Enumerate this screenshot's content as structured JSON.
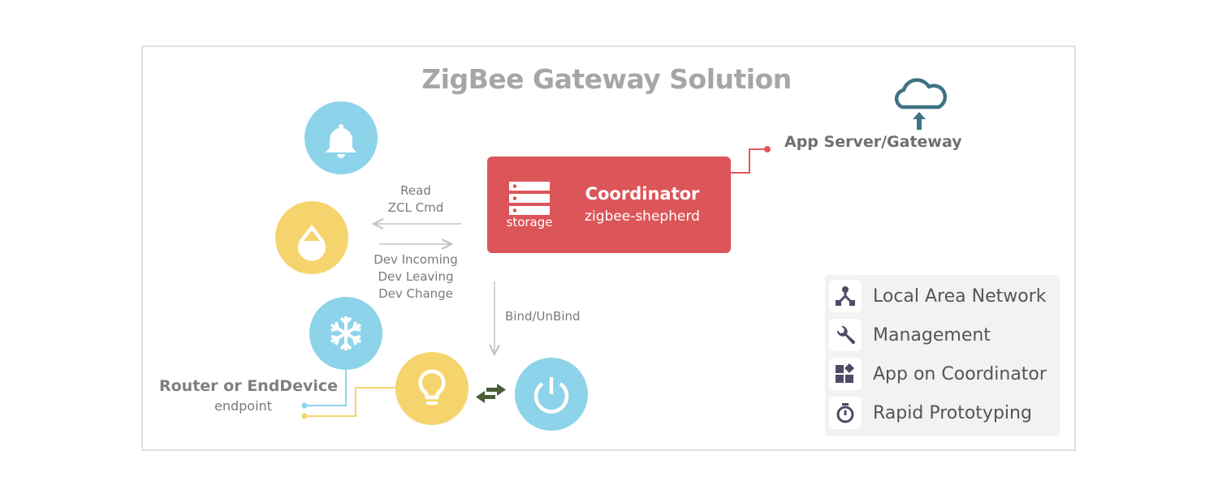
{
  "title": "ZigBee Gateway Solution",
  "colors": {
    "coordinator_red": "#dc5558",
    "device_blue": "#8dd3e9",
    "device_yellow": "#f6d46d",
    "cloud_teal": "#3f7383",
    "bind_arrow_green": "#4a5d36",
    "legend_icon": "#4f4a66",
    "title_grey": "#a6a6a6"
  },
  "coordinator": {
    "title": "Coordinator",
    "subtitle": "zigbee-shepherd",
    "storage_label": "storage",
    "storage_icon": "server-stack-icon"
  },
  "app_server": {
    "label": "App Server/Gateway",
    "icon": "cloud-upload-icon"
  },
  "flows": {
    "to_devices": [
      "Read",
      "ZCL Cmd"
    ],
    "from_devices": [
      "Dev Incoming",
      "Dev Leaving",
      "Dev Change"
    ],
    "bind": "Bind/UnBind"
  },
  "devices": [
    {
      "name": "bell",
      "icon": "bell-icon",
      "color": "blue"
    },
    {
      "name": "drop",
      "icon": "water-drop-icon",
      "color": "yellow"
    },
    {
      "name": "snowflake",
      "icon": "snowflake-icon",
      "color": "blue"
    },
    {
      "name": "bulb",
      "icon": "light-bulb-icon",
      "color": "yellow"
    },
    {
      "name": "power",
      "icon": "power-icon",
      "color": "blue"
    }
  ],
  "device_legend": {
    "title": "Router or EndDevice",
    "subtitle": "endpoint"
  },
  "features": [
    {
      "label": "Local Area Network",
      "icon": "network-icon"
    },
    {
      "label": "Management",
      "icon": "wrench-icon"
    },
    {
      "label": "App on Coordinator",
      "icon": "apps-icon"
    },
    {
      "label": "Rapid Prototyping",
      "icon": "stopwatch-icon"
    }
  ]
}
